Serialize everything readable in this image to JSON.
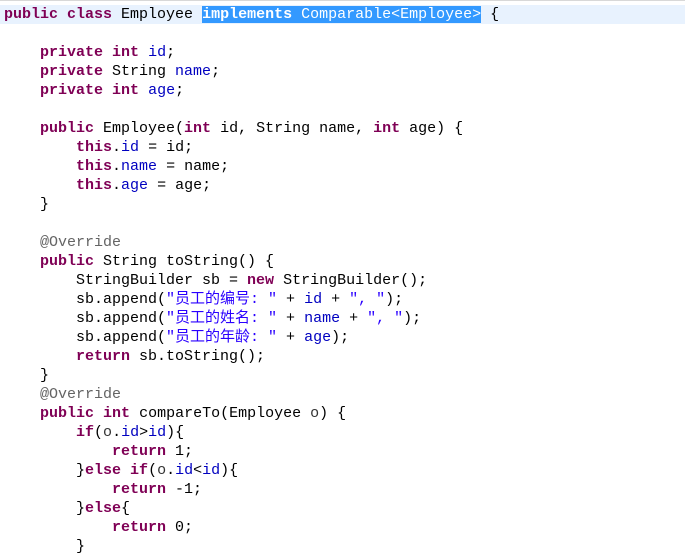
{
  "editor": {
    "current_line": 0,
    "colors": {
      "keyword": "#7f0055",
      "field": "#0000c0",
      "string": "#2a00ff",
      "annotation": "#646464",
      "selection": "#3399ff",
      "current_line": "#e8f2fe"
    },
    "lines": [
      [
        [
          "kw",
          "public"
        ],
        [
          "p",
          " "
        ],
        [
          "kw",
          "class"
        ],
        [
          "p",
          " Employee "
        ],
        [
          "kwsel",
          "implements"
        ],
        [
          "sel",
          " Comparable<Employee>"
        ],
        [
          "p",
          " {"
        ]
      ],
      [],
      [
        [
          "p",
          "    "
        ],
        [
          "kw",
          "private"
        ],
        [
          "p",
          " "
        ],
        [
          "kw",
          "int"
        ],
        [
          "p",
          " "
        ],
        [
          "field",
          "id"
        ],
        [
          "p",
          ";"
        ]
      ],
      [
        [
          "p",
          "    "
        ],
        [
          "kw",
          "private"
        ],
        [
          "p",
          " String "
        ],
        [
          "field",
          "name"
        ],
        [
          "p",
          ";"
        ]
      ],
      [
        [
          "p",
          "    "
        ],
        [
          "kw",
          "private"
        ],
        [
          "p",
          " "
        ],
        [
          "kw",
          "int"
        ],
        [
          "p",
          " "
        ],
        [
          "field",
          "age"
        ],
        [
          "p",
          ";"
        ]
      ],
      [],
      [
        [
          "p",
          "    "
        ],
        [
          "kw",
          "public"
        ],
        [
          "p",
          " Employee("
        ],
        [
          "kw",
          "int"
        ],
        [
          "p",
          " id, String name, "
        ],
        [
          "kw",
          "int"
        ],
        [
          "p",
          " age) {"
        ]
      ],
      [
        [
          "p",
          "        "
        ],
        [
          "kw",
          "this"
        ],
        [
          "p",
          "."
        ],
        [
          "field",
          "id"
        ],
        [
          "p",
          " = id;"
        ]
      ],
      [
        [
          "p",
          "        "
        ],
        [
          "kw",
          "this"
        ],
        [
          "p",
          "."
        ],
        [
          "field",
          "name"
        ],
        [
          "p",
          " = name;"
        ]
      ],
      [
        [
          "p",
          "        "
        ],
        [
          "kw",
          "this"
        ],
        [
          "p",
          "."
        ],
        [
          "field",
          "age"
        ],
        [
          "p",
          " = age;"
        ]
      ],
      [
        [
          "p",
          "    }"
        ]
      ],
      [],
      [
        [
          "p",
          "    "
        ],
        [
          "ann",
          "@Override"
        ]
      ],
      [
        [
          "p",
          "    "
        ],
        [
          "kw",
          "public"
        ],
        [
          "p",
          " String toString() {"
        ]
      ],
      [
        [
          "p",
          "        StringBuilder sb = "
        ],
        [
          "kw",
          "new"
        ],
        [
          "p",
          " StringBuilder();"
        ]
      ],
      [
        [
          "p",
          "        sb.append("
        ],
        [
          "str",
          "\"员工的编号: \""
        ],
        [
          "p",
          " + "
        ],
        [
          "field",
          "id"
        ],
        [
          "p",
          " + "
        ],
        [
          "str",
          "\", \""
        ],
        [
          "p",
          ");"
        ]
      ],
      [
        [
          "p",
          "        sb.append("
        ],
        [
          "str",
          "\"员工的姓名: \""
        ],
        [
          "p",
          " + "
        ],
        [
          "field",
          "name"
        ],
        [
          "p",
          " + "
        ],
        [
          "str",
          "\", \""
        ],
        [
          "p",
          ");"
        ]
      ],
      [
        [
          "p",
          "        sb.append("
        ],
        [
          "str",
          "\"员工的年龄: \""
        ],
        [
          "p",
          " + "
        ],
        [
          "field",
          "age"
        ],
        [
          "p",
          ");"
        ]
      ],
      [
        [
          "p",
          "        "
        ],
        [
          "kw",
          "return"
        ],
        [
          "p",
          " sb.toString();"
        ]
      ],
      [
        [
          "p",
          "    }"
        ]
      ],
      [
        [
          "p",
          "    "
        ],
        [
          "ann",
          "@Override"
        ]
      ],
      [
        [
          "p",
          "    "
        ],
        [
          "kw",
          "public"
        ],
        [
          "p",
          " "
        ],
        [
          "kw",
          "int"
        ],
        [
          "p",
          " compareTo(Employee "
        ],
        [
          "param",
          "o"
        ],
        [
          "p",
          ") {"
        ]
      ],
      [
        [
          "p",
          "        "
        ],
        [
          "kw",
          "if"
        ],
        [
          "p",
          "("
        ],
        [
          "param",
          "o"
        ],
        [
          "p",
          "."
        ],
        [
          "field",
          "id"
        ],
        [
          "p",
          ">"
        ],
        [
          "field",
          "id"
        ],
        [
          "p",
          "){"
        ]
      ],
      [
        [
          "p",
          "            "
        ],
        [
          "kw",
          "return"
        ],
        [
          "p",
          " 1;"
        ]
      ],
      [
        [
          "p",
          "        }"
        ],
        [
          "kw",
          "else"
        ],
        [
          "p",
          " "
        ],
        [
          "kw",
          "if"
        ],
        [
          "p",
          "("
        ],
        [
          "param",
          "o"
        ],
        [
          "p",
          "."
        ],
        [
          "field",
          "id"
        ],
        [
          "p",
          "<"
        ],
        [
          "field",
          "id"
        ],
        [
          "p",
          "){"
        ]
      ],
      [
        [
          "p",
          "            "
        ],
        [
          "kw",
          "return"
        ],
        [
          "p",
          " -1;"
        ]
      ],
      [
        [
          "p",
          "        }"
        ],
        [
          "kw",
          "else"
        ],
        [
          "p",
          "{"
        ]
      ],
      [
        [
          "p",
          "            "
        ],
        [
          "kw",
          "return"
        ],
        [
          "p",
          " 0;"
        ]
      ],
      [
        [
          "p",
          "        }"
        ]
      ]
    ]
  }
}
